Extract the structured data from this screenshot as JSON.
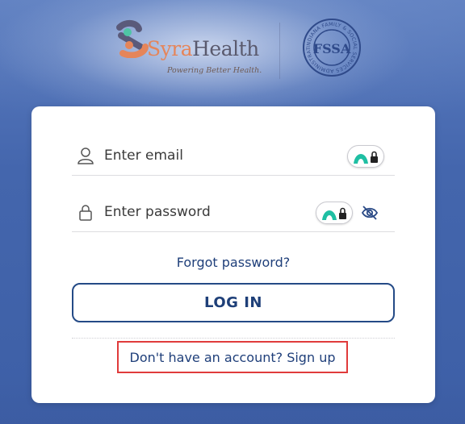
{
  "brand": {
    "name_part1": "Syra",
    "name_part2": "Health",
    "tagline": "Powering Better Health.",
    "seal_letters": "FSSA",
    "seal_ring_text": "INDIANA FAMILY & SOCIAL SERVICES ADMINISTRATION"
  },
  "form": {
    "email_placeholder": "Enter email",
    "email_value": "",
    "password_placeholder": "Enter password",
    "password_value": "",
    "forgot_label": "Forgot password?",
    "login_label": "LOG IN",
    "signup_label": "Don't have an account? Sign up"
  },
  "icons": {
    "email": "user-icon",
    "password": "lock-icon",
    "password_manager": "password-manager-icon",
    "visibility": "eye-off-icon"
  },
  "colors": {
    "background": "#3f62a8",
    "primary": "#1e3f78",
    "brand_orange": "#e5855a",
    "highlight": "#e03b3b"
  }
}
